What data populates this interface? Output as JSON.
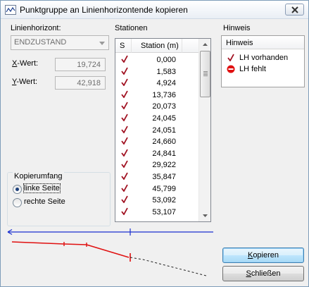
{
  "window": {
    "title": "Punktgruppe an Linienhorizontende kopieren"
  },
  "left": {
    "linienhorizont_label": "Linienhorizont:",
    "linienhorizont_value": "ENDZUSTAND",
    "x_label": "X-Wert:",
    "x_value": "19,724",
    "y_label": "Y-Wert:",
    "y_value": "42,918"
  },
  "kopierumfang": {
    "title": "Kopierumfang",
    "options": [
      {
        "label": "linke Seite",
        "selected": true
      },
      {
        "label": "rechte Seite",
        "selected": false
      }
    ]
  },
  "stationen": {
    "title": "Stationen",
    "columns": [
      "S",
      "Station (m)"
    ],
    "rows": [
      {
        "mark": "✓",
        "value": "0,000"
      },
      {
        "mark": "✓",
        "value": "1,583"
      },
      {
        "mark": "✓",
        "value": "4,924"
      },
      {
        "mark": "✓",
        "value": "13,736"
      },
      {
        "mark": "✓",
        "value": "20,073"
      },
      {
        "mark": "✓",
        "value": "24,045"
      },
      {
        "mark": "✓",
        "value": "24,051"
      },
      {
        "mark": "✓",
        "value": "24,660"
      },
      {
        "mark": "✓",
        "value": "24,841"
      },
      {
        "mark": "✓",
        "value": "29,922"
      },
      {
        "mark": "✓",
        "value": "35,847"
      },
      {
        "mark": "✓",
        "value": "45,799"
      },
      {
        "mark": "✓",
        "value": "53,092"
      },
      {
        "mark": "✓",
        "value": "53,107"
      }
    ]
  },
  "hinweis": {
    "title": "Hinweis",
    "header": "Hinweis",
    "items": [
      {
        "icon": "check-icon",
        "label": "LH vorhanden"
      },
      {
        "icon": "no-entry-icon",
        "label": "LH fehlt"
      }
    ]
  },
  "buttons": {
    "copy": "Kopieren",
    "close": "Schließen"
  },
  "colors": {
    "accent_red": "#e01010",
    "preview_blue": "#0000cc",
    "check_red": "#a01020"
  }
}
